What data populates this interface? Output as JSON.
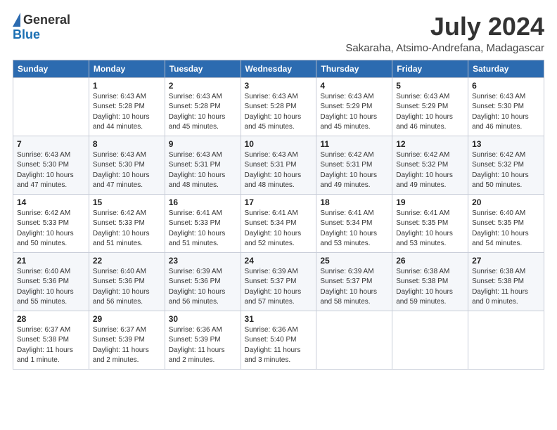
{
  "header": {
    "logo_general": "General",
    "logo_blue": "Blue",
    "month_title": "July 2024",
    "subtitle": "Sakaraha, Atsimo-Andrefana, Madagascar"
  },
  "calendar": {
    "days_of_week": [
      "Sunday",
      "Monday",
      "Tuesday",
      "Wednesday",
      "Thursday",
      "Friday",
      "Saturday"
    ],
    "weeks": [
      [
        {
          "day": "",
          "info": ""
        },
        {
          "day": "1",
          "info": "Sunrise: 6:43 AM\nSunset: 5:28 PM\nDaylight: 10 hours\nand 44 minutes."
        },
        {
          "day": "2",
          "info": "Sunrise: 6:43 AM\nSunset: 5:28 PM\nDaylight: 10 hours\nand 45 minutes."
        },
        {
          "day": "3",
          "info": "Sunrise: 6:43 AM\nSunset: 5:28 PM\nDaylight: 10 hours\nand 45 minutes."
        },
        {
          "day": "4",
          "info": "Sunrise: 6:43 AM\nSunset: 5:29 PM\nDaylight: 10 hours\nand 45 minutes."
        },
        {
          "day": "5",
          "info": "Sunrise: 6:43 AM\nSunset: 5:29 PM\nDaylight: 10 hours\nand 46 minutes."
        },
        {
          "day": "6",
          "info": "Sunrise: 6:43 AM\nSunset: 5:30 PM\nDaylight: 10 hours\nand 46 minutes."
        }
      ],
      [
        {
          "day": "7",
          "info": "Sunrise: 6:43 AM\nSunset: 5:30 PM\nDaylight: 10 hours\nand 47 minutes."
        },
        {
          "day": "8",
          "info": "Sunrise: 6:43 AM\nSunset: 5:30 PM\nDaylight: 10 hours\nand 47 minutes."
        },
        {
          "day": "9",
          "info": "Sunrise: 6:43 AM\nSunset: 5:31 PM\nDaylight: 10 hours\nand 48 minutes."
        },
        {
          "day": "10",
          "info": "Sunrise: 6:43 AM\nSunset: 5:31 PM\nDaylight: 10 hours\nand 48 minutes."
        },
        {
          "day": "11",
          "info": "Sunrise: 6:42 AM\nSunset: 5:31 PM\nDaylight: 10 hours\nand 49 minutes."
        },
        {
          "day": "12",
          "info": "Sunrise: 6:42 AM\nSunset: 5:32 PM\nDaylight: 10 hours\nand 49 minutes."
        },
        {
          "day": "13",
          "info": "Sunrise: 6:42 AM\nSunset: 5:32 PM\nDaylight: 10 hours\nand 50 minutes."
        }
      ],
      [
        {
          "day": "14",
          "info": "Sunrise: 6:42 AM\nSunset: 5:33 PM\nDaylight: 10 hours\nand 50 minutes."
        },
        {
          "day": "15",
          "info": "Sunrise: 6:42 AM\nSunset: 5:33 PM\nDaylight: 10 hours\nand 51 minutes."
        },
        {
          "day": "16",
          "info": "Sunrise: 6:41 AM\nSunset: 5:33 PM\nDaylight: 10 hours\nand 51 minutes."
        },
        {
          "day": "17",
          "info": "Sunrise: 6:41 AM\nSunset: 5:34 PM\nDaylight: 10 hours\nand 52 minutes."
        },
        {
          "day": "18",
          "info": "Sunrise: 6:41 AM\nSunset: 5:34 PM\nDaylight: 10 hours\nand 53 minutes."
        },
        {
          "day": "19",
          "info": "Sunrise: 6:41 AM\nSunset: 5:35 PM\nDaylight: 10 hours\nand 53 minutes."
        },
        {
          "day": "20",
          "info": "Sunrise: 6:40 AM\nSunset: 5:35 PM\nDaylight: 10 hours\nand 54 minutes."
        }
      ],
      [
        {
          "day": "21",
          "info": "Sunrise: 6:40 AM\nSunset: 5:36 PM\nDaylight: 10 hours\nand 55 minutes."
        },
        {
          "day": "22",
          "info": "Sunrise: 6:40 AM\nSunset: 5:36 PM\nDaylight: 10 hours\nand 56 minutes."
        },
        {
          "day": "23",
          "info": "Sunrise: 6:39 AM\nSunset: 5:36 PM\nDaylight: 10 hours\nand 56 minutes."
        },
        {
          "day": "24",
          "info": "Sunrise: 6:39 AM\nSunset: 5:37 PM\nDaylight: 10 hours\nand 57 minutes."
        },
        {
          "day": "25",
          "info": "Sunrise: 6:39 AM\nSunset: 5:37 PM\nDaylight: 10 hours\nand 58 minutes."
        },
        {
          "day": "26",
          "info": "Sunrise: 6:38 AM\nSunset: 5:38 PM\nDaylight: 10 hours\nand 59 minutes."
        },
        {
          "day": "27",
          "info": "Sunrise: 6:38 AM\nSunset: 5:38 PM\nDaylight: 11 hours\nand 0 minutes."
        }
      ],
      [
        {
          "day": "28",
          "info": "Sunrise: 6:37 AM\nSunset: 5:38 PM\nDaylight: 11 hours\nand 1 minute."
        },
        {
          "day": "29",
          "info": "Sunrise: 6:37 AM\nSunset: 5:39 PM\nDaylight: 11 hours\nand 2 minutes."
        },
        {
          "day": "30",
          "info": "Sunrise: 6:36 AM\nSunset: 5:39 PM\nDaylight: 11 hours\nand 2 minutes."
        },
        {
          "day": "31",
          "info": "Sunrise: 6:36 AM\nSunset: 5:40 PM\nDaylight: 11 hours\nand 3 minutes."
        },
        {
          "day": "",
          "info": ""
        },
        {
          "day": "",
          "info": ""
        },
        {
          "day": "",
          "info": ""
        }
      ]
    ]
  }
}
